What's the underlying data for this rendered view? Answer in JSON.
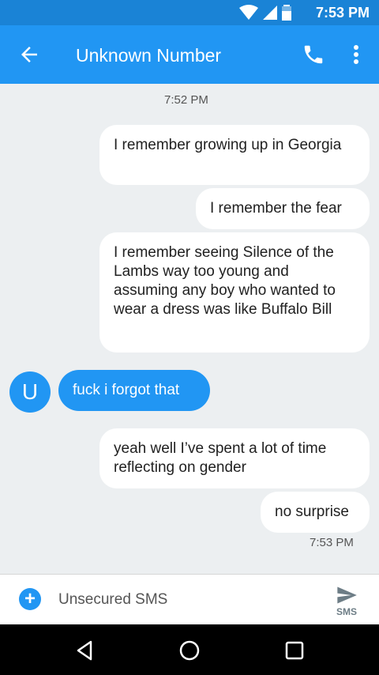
{
  "status_bar": {
    "time": "7:53 PM"
  },
  "app_bar": {
    "title": "Unknown Number"
  },
  "thread": {
    "timestamp_top": "7:52 PM",
    "messages": [
      {
        "direction": "out",
        "text": "I remember growing up in Georgia"
      },
      {
        "direction": "out",
        "text": "I remember the fear"
      },
      {
        "direction": "out",
        "text": "I remember seeing Silence of the Lambs way too young and assuming any boy who wanted to wear a dress was like Buffalo Bill"
      },
      {
        "direction": "in",
        "text": "fuck i forgot that"
      },
      {
        "direction": "out",
        "text": "yeah well I’ve spent a lot of time reflecting on gender"
      },
      {
        "direction": "out",
        "text": "no surprise"
      }
    ],
    "timestamp_bottom": "7:53 PM",
    "avatar_letter": "U"
  },
  "composer": {
    "placeholder": "Unsecured SMS",
    "send_label": "SMS"
  },
  "colors": {
    "primary": "#2196f3",
    "status_bar": "#1a83d6",
    "background": "#eceff1"
  }
}
